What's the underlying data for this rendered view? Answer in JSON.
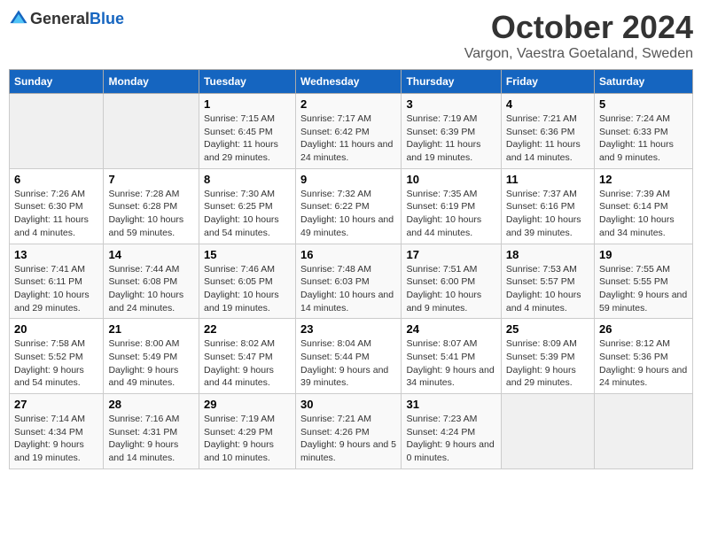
{
  "header": {
    "logo_general": "General",
    "logo_blue": "Blue",
    "title": "October 2024",
    "subtitle": "Vargon, Vaestra Goetaland, Sweden"
  },
  "days_of_week": [
    "Sunday",
    "Monday",
    "Tuesday",
    "Wednesday",
    "Thursday",
    "Friday",
    "Saturday"
  ],
  "weeks": [
    [
      {
        "day": "",
        "empty": true
      },
      {
        "day": "",
        "empty": true
      },
      {
        "day": "1",
        "sunrise": "Sunrise: 7:15 AM",
        "sunset": "Sunset: 6:45 PM",
        "daylight": "Daylight: 11 hours and 29 minutes."
      },
      {
        "day": "2",
        "sunrise": "Sunrise: 7:17 AM",
        "sunset": "Sunset: 6:42 PM",
        "daylight": "Daylight: 11 hours and 24 minutes."
      },
      {
        "day": "3",
        "sunrise": "Sunrise: 7:19 AM",
        "sunset": "Sunset: 6:39 PM",
        "daylight": "Daylight: 11 hours and 19 minutes."
      },
      {
        "day": "4",
        "sunrise": "Sunrise: 7:21 AM",
        "sunset": "Sunset: 6:36 PM",
        "daylight": "Daylight: 11 hours and 14 minutes."
      },
      {
        "day": "5",
        "sunrise": "Sunrise: 7:24 AM",
        "sunset": "Sunset: 6:33 PM",
        "daylight": "Daylight: 11 hours and 9 minutes."
      }
    ],
    [
      {
        "day": "6",
        "sunrise": "Sunrise: 7:26 AM",
        "sunset": "Sunset: 6:30 PM",
        "daylight": "Daylight: 11 hours and 4 minutes."
      },
      {
        "day": "7",
        "sunrise": "Sunrise: 7:28 AM",
        "sunset": "Sunset: 6:28 PM",
        "daylight": "Daylight: 10 hours and 59 minutes."
      },
      {
        "day": "8",
        "sunrise": "Sunrise: 7:30 AM",
        "sunset": "Sunset: 6:25 PM",
        "daylight": "Daylight: 10 hours and 54 minutes."
      },
      {
        "day": "9",
        "sunrise": "Sunrise: 7:32 AM",
        "sunset": "Sunset: 6:22 PM",
        "daylight": "Daylight: 10 hours and 49 minutes."
      },
      {
        "day": "10",
        "sunrise": "Sunrise: 7:35 AM",
        "sunset": "Sunset: 6:19 PM",
        "daylight": "Daylight: 10 hours and 44 minutes."
      },
      {
        "day": "11",
        "sunrise": "Sunrise: 7:37 AM",
        "sunset": "Sunset: 6:16 PM",
        "daylight": "Daylight: 10 hours and 39 minutes."
      },
      {
        "day": "12",
        "sunrise": "Sunrise: 7:39 AM",
        "sunset": "Sunset: 6:14 PM",
        "daylight": "Daylight: 10 hours and 34 minutes."
      }
    ],
    [
      {
        "day": "13",
        "sunrise": "Sunrise: 7:41 AM",
        "sunset": "Sunset: 6:11 PM",
        "daylight": "Daylight: 10 hours and 29 minutes."
      },
      {
        "day": "14",
        "sunrise": "Sunrise: 7:44 AM",
        "sunset": "Sunset: 6:08 PM",
        "daylight": "Daylight: 10 hours and 24 minutes."
      },
      {
        "day": "15",
        "sunrise": "Sunrise: 7:46 AM",
        "sunset": "Sunset: 6:05 PM",
        "daylight": "Daylight: 10 hours and 19 minutes."
      },
      {
        "day": "16",
        "sunrise": "Sunrise: 7:48 AM",
        "sunset": "Sunset: 6:03 PM",
        "daylight": "Daylight: 10 hours and 14 minutes."
      },
      {
        "day": "17",
        "sunrise": "Sunrise: 7:51 AM",
        "sunset": "Sunset: 6:00 PM",
        "daylight": "Daylight: 10 hours and 9 minutes."
      },
      {
        "day": "18",
        "sunrise": "Sunrise: 7:53 AM",
        "sunset": "Sunset: 5:57 PM",
        "daylight": "Daylight: 10 hours and 4 minutes."
      },
      {
        "day": "19",
        "sunrise": "Sunrise: 7:55 AM",
        "sunset": "Sunset: 5:55 PM",
        "daylight": "Daylight: 9 hours and 59 minutes."
      }
    ],
    [
      {
        "day": "20",
        "sunrise": "Sunrise: 7:58 AM",
        "sunset": "Sunset: 5:52 PM",
        "daylight": "Daylight: 9 hours and 54 minutes."
      },
      {
        "day": "21",
        "sunrise": "Sunrise: 8:00 AM",
        "sunset": "Sunset: 5:49 PM",
        "daylight": "Daylight: 9 hours and 49 minutes."
      },
      {
        "day": "22",
        "sunrise": "Sunrise: 8:02 AM",
        "sunset": "Sunset: 5:47 PM",
        "daylight": "Daylight: 9 hours and 44 minutes."
      },
      {
        "day": "23",
        "sunrise": "Sunrise: 8:04 AM",
        "sunset": "Sunset: 5:44 PM",
        "daylight": "Daylight: 9 hours and 39 minutes."
      },
      {
        "day": "24",
        "sunrise": "Sunrise: 8:07 AM",
        "sunset": "Sunset: 5:41 PM",
        "daylight": "Daylight: 9 hours and 34 minutes."
      },
      {
        "day": "25",
        "sunrise": "Sunrise: 8:09 AM",
        "sunset": "Sunset: 5:39 PM",
        "daylight": "Daylight: 9 hours and 29 minutes."
      },
      {
        "day": "26",
        "sunrise": "Sunrise: 8:12 AM",
        "sunset": "Sunset: 5:36 PM",
        "daylight": "Daylight: 9 hours and 24 minutes."
      }
    ],
    [
      {
        "day": "27",
        "sunrise": "Sunrise: 7:14 AM",
        "sunset": "Sunset: 4:34 PM",
        "daylight": "Daylight: 9 hours and 19 minutes."
      },
      {
        "day": "28",
        "sunrise": "Sunrise: 7:16 AM",
        "sunset": "Sunset: 4:31 PM",
        "daylight": "Daylight: 9 hours and 14 minutes."
      },
      {
        "day": "29",
        "sunrise": "Sunrise: 7:19 AM",
        "sunset": "Sunset: 4:29 PM",
        "daylight": "Daylight: 9 hours and 10 minutes."
      },
      {
        "day": "30",
        "sunrise": "Sunrise: 7:21 AM",
        "sunset": "Sunset: 4:26 PM",
        "daylight": "Daylight: 9 hours and 5 minutes."
      },
      {
        "day": "31",
        "sunrise": "Sunrise: 7:23 AM",
        "sunset": "Sunset: 4:24 PM",
        "daylight": "Daylight: 9 hours and 0 minutes."
      },
      {
        "day": "",
        "empty": true
      },
      {
        "day": "",
        "empty": true
      }
    ]
  ]
}
